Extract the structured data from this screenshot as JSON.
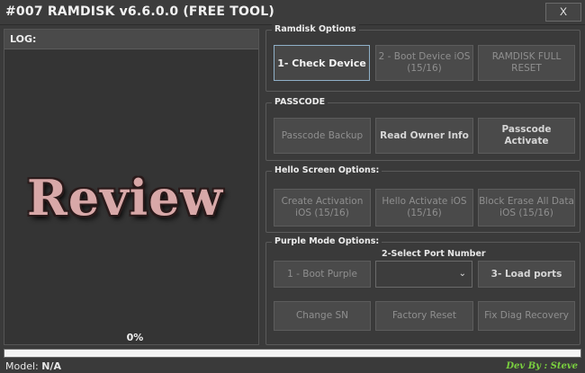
{
  "window": {
    "title": "#007 RAMDISK v6.6.0.0 (FREE TOOL)",
    "close_label": "X"
  },
  "log": {
    "label": "LOG:",
    "percent": "0%"
  },
  "watermark": "Review",
  "ramdisk_options": {
    "title": "Ramdisk Options",
    "check_device": "1- Check Device",
    "boot_device": "2 - Boot Device iOS (15/16)",
    "ramdisk_full_reset": "RAMDISK FULL RESET"
  },
  "passcode": {
    "title": "PASSCODE",
    "backup": "Passcode Backup",
    "read_owner_info": "Read Owner Info",
    "activate": "Passcode Activate"
  },
  "hello_screen": {
    "title": "Hello Screen Options:",
    "create_activation": "Create Activation iOS (15/16)",
    "hello_activate": "Hello Activate iOS (15/16)",
    "block_erase": "Block Erase All Data iOS (15/16)"
  },
  "purple_mode": {
    "title": "Purple Mode Options:",
    "port_label": "2-Select Port Number",
    "boot_purple": "1 - Boot Purple",
    "port_value": "",
    "load_ports": "3- Load ports",
    "change_sn": "Change SN",
    "factory_reset": "Factory Reset",
    "fix_diag_recovery": "Fix Diag Recovery"
  },
  "progress": {
    "fraction": 0.0
  },
  "status": {
    "model_label": "Model:",
    "model_value": "N/A",
    "dev_by": "Dev By : Steve"
  },
  "colors": {
    "background": "#3a3a3a",
    "active_border": "#8fb0c8",
    "dev_credit": "#7ad13f"
  }
}
